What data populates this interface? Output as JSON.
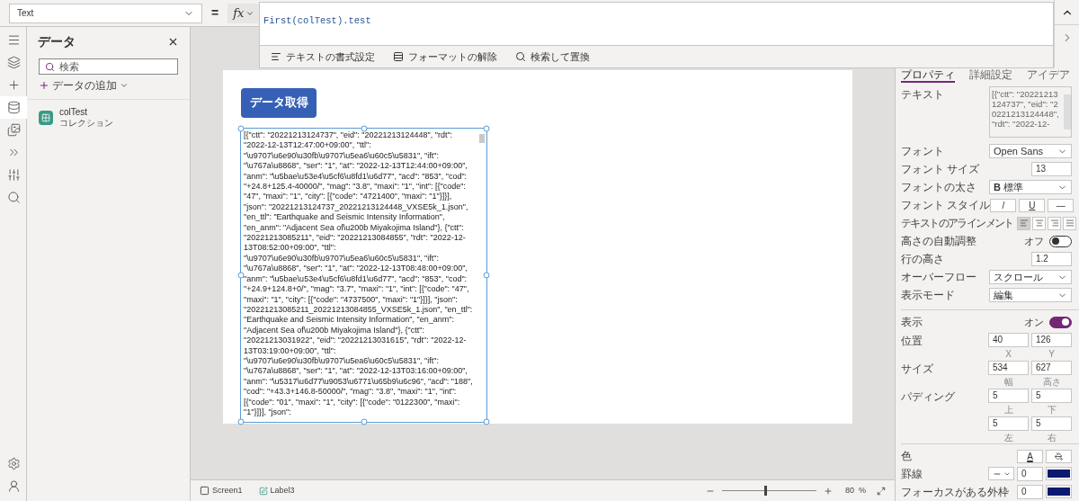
{
  "property_selector": {
    "value": "Text"
  },
  "equals": "=",
  "fx_button": {
    "label": "fx"
  },
  "formula": {
    "text": "First(colTest).test"
  },
  "formula_toolbar": [
    {
      "label": "テキストの書式設定",
      "kind": "format"
    },
    {
      "label": "フォーマットの解除",
      "kind": "clear"
    },
    {
      "label": "検索して置換",
      "kind": "search"
    }
  ],
  "left_rail": [
    {
      "kind": "menu",
      "selected": false
    },
    {
      "kind": "layers",
      "selected": false
    },
    {
      "kind": "insert",
      "selected": false
    },
    {
      "kind": "data",
      "selected": true
    },
    {
      "kind": "media",
      "selected": false
    },
    {
      "kind": "automate",
      "selected": false
    },
    {
      "kind": "tools",
      "selected": false
    },
    {
      "kind": "search",
      "selected": false
    }
  ],
  "left_rail_bottom": [
    {
      "kind": "settings",
      "selected": false
    },
    {
      "kind": "account",
      "selected": false
    }
  ],
  "data_panel": {
    "title": "データ",
    "search": {
      "placeholder": "検索"
    },
    "add_data": "データの追加",
    "items": [
      {
        "name": "colTest",
        "type": "コレクション"
      }
    ]
  },
  "canvas": {
    "button": {
      "label": "データ取得"
    },
    "label": {
      "selected": true,
      "text": "[{\"ctt\": \"20221213124737\", \"eid\": \"20221213124448\", \"rdt\": \"2022-12-13T12:47:00+09:00\", \"ttl\": \"\\u9707\\u6e90\\u30fb\\u9707\\u5ea6\\u60c5\\u5831\", \"ift\": \"\\u767a\\u8868\", \"ser\": \"1\", \"at\": \"2022-12-13T12:44:00+09:00\", \"anm\": \"\\u5bae\\u53e4\\u5cf6\\u8fd1\\u6d77\", \"acd\": \"853\", \"cod\": \"+24.8+125.4-40000/\", \"mag\": \"3.8\", \"maxi\": \"1\", \"int\": [{\"code\": \"47\", \"maxi\": \"1\", \"city\": [{\"code\": \"4721400\", \"maxi\": \"1\"}]}], \"json\": \"20221213124737_20221213124448_VXSE5k_1.json\", \"en_ttl\": \"Earthquake and Seismic Intensity Information\", \"en_anm\": \"Adjacent Sea of\\u200b Miyakojima Island\"}, {\"ctt\": \"20221213085211\", \"eid\": \"20221213084855\", \"rdt\": \"2022-12-13T08:52:00+09:00\", \"ttl\": \"\\u9707\\u6e90\\u30fb\\u9707\\u5ea6\\u60c5\\u5831\", \"ift\": \"\\u767a\\u8868\", \"ser\": \"1\", \"at\": \"2022-12-13T08:48:00+09:00\", \"anm\": \"\\u5bae\\u53e4\\u5cf6\\u8fd1\\u6d77\", \"acd\": \"853\", \"cod\": \"+24.9+124.8+0/\", \"mag\": \"3.7\", \"maxi\": \"1\", \"int\": [{\"code\": \"47\", \"maxi\": \"1\", \"city\": [{\"code\": \"4737500\", \"maxi\": \"1\"}]}], \"json\": \"20221213085211_20221213084855_VXSE5k_1.json\", \"en_ttl\": \"Earthquake and Seismic Intensity Information\", \"en_anm\": \"Adjacent Sea of\\u200b Miyakojima Island\"}, {\"ctt\": \"20221213031922\", \"eid\": \"20221213031615\", \"rdt\": \"2022-12-13T03:19:00+09:00\", \"ttl\": \"\\u9707\\u6e90\\u30fb\\u9707\\u5ea6\\u60c5\\u5831\", \"ift\": \"\\u767a\\u8868\", \"ser\": \"1\", \"at\": \"2022-12-13T03:16:00+09:00\", \"anm\": \"\\u5317\\u6d77\\u9053\\u6771\\u65b9\\u6c96\", \"acd\": \"188\", \"cod\": \"+43.3+146.8-50000/\", \"mag\": \"3.8\", \"maxi\": \"1\", \"int\": [{\"code\": \"01\", \"maxi\": \"1\", \"city\": [{\"code\": \"0122300\", \"maxi\": \"1\"}]}], \"json\":"
    }
  },
  "status_bar": {
    "screen": "Screen1",
    "control": "Label3",
    "zoom": {
      "level": 0.45
    },
    "zoom_value": "80",
    "zoom_unit": "%"
  },
  "properties_panel": {
    "tabs": [
      {
        "label": "プロパティ",
        "selected": true
      },
      {
        "label": "詳細設定",
        "selected": false
      },
      {
        "label": "アイデア",
        "selected": false
      }
    ],
    "sections": [
      {
        "rows": [
          {
            "kind": "textbox",
            "label": "テキスト",
            "value": "[{\"ctt\": \"20221213124737\", \"eid\": \"20221213124448\", \"rdt\": \"2022-12-"
          },
          {
            "kind": "dropdown",
            "label": "フォント",
            "value": "Open Sans"
          },
          {
            "kind": "number",
            "label": "フォント サイズ",
            "value": "13"
          },
          {
            "kind": "dropdown",
            "label": "フォントの太さ",
            "value": "**B** 標準"
          },
          {
            "kind": "font-style",
            "label": "フォント スタイル",
            "buttons": [
              {
                "label": "/",
                "selected": false
              },
              {
                "label": "U",
                "selected": false
              },
              {
                "label": "—",
                "selected": false
              }
            ]
          },
          {
            "kind": "align",
            "label": "テキストのアラインメント",
            "options": [
              {
                "selected": true
              },
              {
                "selected": false
              },
              {
                "selected": false
              },
              {
                "selected": false
              }
            ]
          },
          {
            "kind": "toggle",
            "label": "高さの自動調整",
            "state": "オフ",
            "on": false
          },
          {
            "kind": "number",
            "label": "行の高さ",
            "value": "1.2"
          },
          {
            "kind": "dropdown",
            "label": "オーバーフロー",
            "value": "スクロール"
          },
          {
            "kind": "dropdown",
            "label": "表示モード",
            "value": "編集"
          }
        ]
      },
      {
        "rows": [
          {
            "kind": "toggle",
            "label": "表示",
            "state": "オン",
            "on": true
          },
          {
            "kind": "pair",
            "label": "位置",
            "fields": [
              {
                "value": "40",
                "caption": "X"
              },
              {
                "value": "126",
                "caption": "Y"
              }
            ]
          },
          {
            "kind": "pair",
            "label": "サイズ",
            "fields": [
              {
                "value": "534",
                "caption": "幅"
              },
              {
                "value": "627",
                "caption": "高さ"
              }
            ]
          },
          {
            "kind": "pair",
            "label": "パディング",
            "fields": [
              {
                "value": "5",
                "caption": "上"
              },
              {
                "value": "5",
                "caption": "下"
              }
            ]
          },
          {
            "kind": "pair",
            "fields": [
              {
                "value": "5",
                "caption": "左"
              },
              {
                "value": "5",
                "caption": "右"
              }
            ]
          }
        ]
      },
      {
        "rows": [
          {
            "kind": "color",
            "label": "色",
            "font_color": "A"
          },
          {
            "kind": "border-style",
            "label": "罫線",
            "value": "0",
            "color": "#0a1a6e"
          },
          {
            "kind": "border",
            "label": "フォーカスがある外枠",
            "value": "0",
            "color": "#0a1a6e"
          }
        ]
      }
    ]
  }
}
